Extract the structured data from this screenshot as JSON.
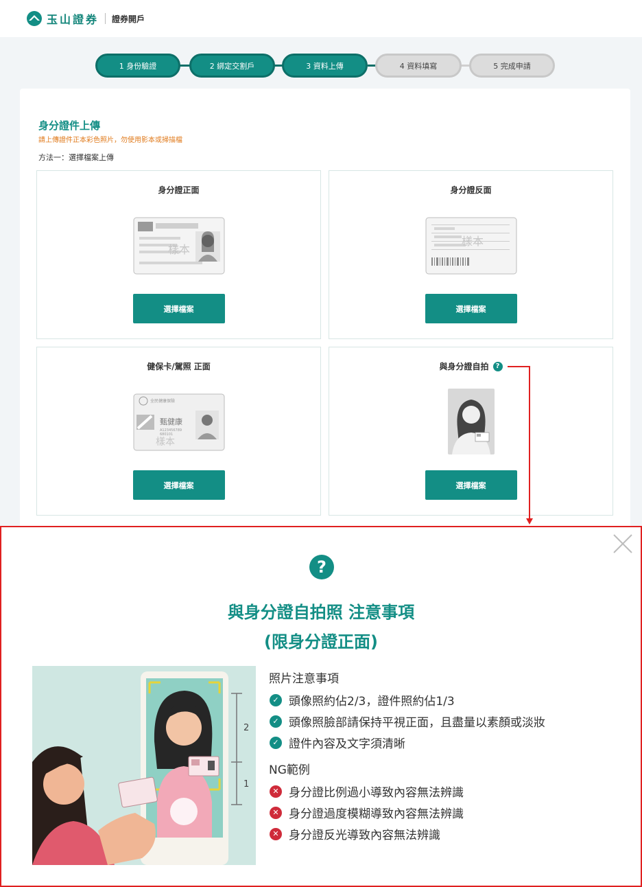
{
  "header": {
    "brand": "玉山證券",
    "section": "證券開戶"
  },
  "steps": [
    {
      "label": "1 身份驗證",
      "state": "done"
    },
    {
      "label": "2 綁定交割戶",
      "state": "done"
    },
    {
      "label": "3 資料上傳",
      "state": "done"
    },
    {
      "label": "4 資料填寫",
      "state": "todo"
    },
    {
      "label": "5 完成申請",
      "state": "todo"
    }
  ],
  "upload": {
    "title": "身分證件上傳",
    "note": "請上傳證件正本彩色照片，勿使用影本或掃描檔",
    "method": "方法一：選擇檔案上傳",
    "boxes": [
      {
        "title": "身分證正面",
        "button": "選擇檔案"
      },
      {
        "title": "身分證反面",
        "button": "選擇檔案"
      },
      {
        "title": "健保卡/駕照 正面",
        "button": "選擇檔案"
      },
      {
        "title": "與身分證自拍",
        "button": "選擇檔案",
        "help": "?"
      }
    ],
    "sample_stamp": "樣本",
    "health_card": {
      "agency": "全民健康保險",
      "name": "甄健康",
      "id": "A123456789",
      "birth": "680101"
    }
  },
  "popup": {
    "icon": "?",
    "title": "與身分證自拍照 注意事項",
    "subtitle": "(限身分證正面)",
    "ratio_labels": [
      "2",
      "1"
    ],
    "tips_heading": "照片注意事項",
    "tips": [
      "頭像照約佔2/3，證件照約佔1/3",
      "頭像照臉部請保持平視正面，且盡量以素顏或淡妝",
      "證件內容及文字須清晰"
    ],
    "ng_heading": "NG範例",
    "ng": [
      "身分證比例過小導致內容無法辨識",
      "身分證過度模糊導致內容無法辨識",
      "身分證反光導致內容無法辨識"
    ]
  },
  "colors": {
    "brand": "#138e85",
    "warning": "#e07a1b",
    "error": "#cf2b3a",
    "annotation": "#e02020"
  }
}
